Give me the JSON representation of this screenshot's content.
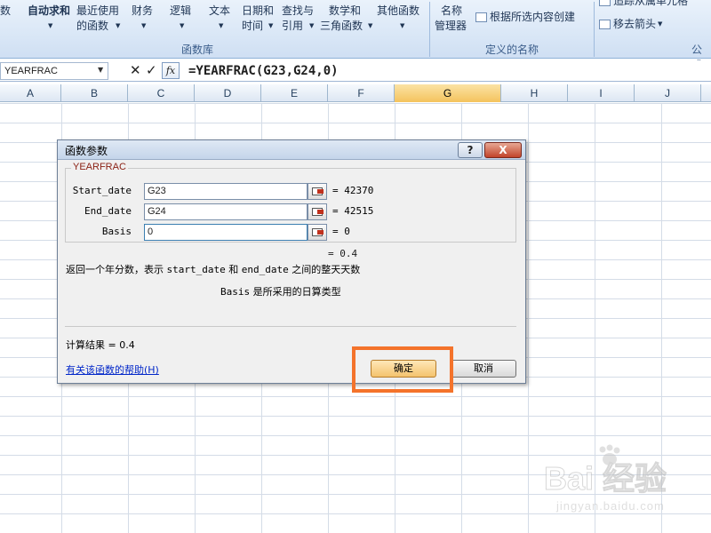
{
  "ribbon": {
    "buttons": {
      "insert_function_partial": "数",
      "autosum": "自动求和",
      "recent": [
        "最近使用",
        "的函数"
      ],
      "financial": "财务",
      "logical": "逻辑",
      "text": "文本",
      "datetime": [
        "日期和",
        "时间"
      ],
      "lookup": [
        "查找与",
        "引用"
      ],
      "math": [
        "数学和",
        "三角函数"
      ],
      "more": "其他函数",
      "name_manager": [
        "名称",
        "管理器"
      ],
      "create_from_selection": "根据所选内容创建",
      "trace_dependents_partial": "追踪从属单元格",
      "remove_arrows": "移去箭头"
    },
    "groups": {
      "function_library": "函数库",
      "defined_names": "定义的名称",
      "formula_auditing_partial": "公式"
    }
  },
  "formula_bar": {
    "name_box": "YEARFRAC",
    "fx_label": "fx",
    "formula": "=YEARFRAC(G23,G24,0)"
  },
  "columns": [
    "A",
    "B",
    "C",
    "D",
    "E",
    "F",
    "G",
    "H",
    "I",
    "J"
  ],
  "dialog": {
    "title": "函数参数",
    "help_button": "?",
    "close_button": "X",
    "function_name": "YEARFRAC",
    "args": [
      {
        "label": "Start_date",
        "value": "G23",
        "result": "= 42370"
      },
      {
        "label": "End_date",
        "value": "G24",
        "result": "= 42515"
      },
      {
        "label": "Basis",
        "value": "0",
        "result": "= 0"
      }
    ],
    "formula_result_preview": "= 0.4",
    "description": {
      "prefix": "返回一个年分数，表示",
      "arg1": "start_date",
      "middle": "和",
      "arg2": "end_date",
      "suffix": "之间的整天天数"
    },
    "arg_description": {
      "arg": "Basis",
      "text": "是所采用的日算类型"
    },
    "calc_result": "计算结果 = 0.4",
    "help_link": "有关该函数的帮助(H)",
    "ok_button": "确定",
    "cancel_button": "取消"
  },
  "watermark": {
    "main": "Bai 经验",
    "sub": "jingyan.baidu.com"
  }
}
